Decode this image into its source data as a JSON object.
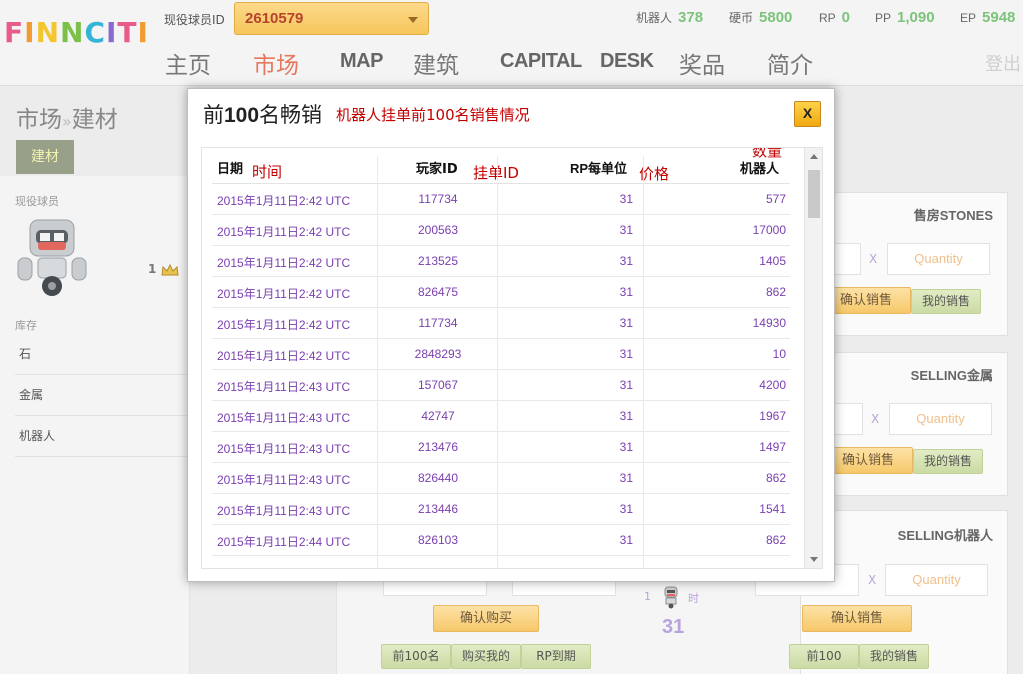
{
  "header": {
    "logo": "FINNCITI",
    "player_id_label": "现役球员ID",
    "player_id_value": "2610579",
    "stats": [
      {
        "label": "机器人",
        "value": "378"
      },
      {
        "label": "硬币",
        "value": "5800"
      },
      {
        "label": "RP",
        "value": "0"
      },
      {
        "label": "PP",
        "value": "1,090"
      },
      {
        "label": "EP",
        "value": "5948"
      }
    ],
    "nav": [
      "主页",
      "市场",
      "MAP",
      "建筑",
      "CAPITAL",
      "DESK",
      "奖品",
      "简介"
    ],
    "active_nav": "市场",
    "logout": "登出"
  },
  "left": {
    "breadcrumb_a": "市场",
    "breadcrumb_sep": "»",
    "breadcrumb_b": "建材",
    "tab": "建材",
    "player_title": "现役球员",
    "crown_count": "1",
    "inventory_title": "库存",
    "inventory": [
      "石",
      "金属",
      "机器人"
    ]
  },
  "sell_panels": [
    {
      "title": "售房STONES",
      "qty_placeholder": "Quantity",
      "x": "X",
      "confirm": "确认销售",
      "mine": "我的销售"
    },
    {
      "title": "SELLING金属",
      "qty_placeholder": "Quantity",
      "x": "X",
      "confirm": "确认销售",
      "mine": "我的销售"
    },
    {
      "title": "SELLING机器人",
      "qty_placeholder": "Quantity",
      "x": "X",
      "confirm": "确认销售",
      "mine": "我的销售"
    }
  ],
  "bottom": {
    "buy_confirm": "确认购买",
    "top100": "前100名",
    "buy_mine": "购买我的",
    "rp_expire": "RP到期",
    "small_1": "1",
    "shi": "时",
    "big_31": "31",
    "top100_right": "前100",
    "mine_right": "我的销售"
  },
  "modal": {
    "title_a": "前",
    "title_b": "100",
    "title_c": "名畅销",
    "annotation_title": "机器人挂单前100名销售情况",
    "close": "X",
    "columns": [
      "日期",
      "玩家ID",
      "RP每单位",
      "机器人"
    ],
    "annotations": {
      "date": "时间",
      "id": "挂单ID",
      "price": "价格",
      "qty": "数量"
    },
    "rows": [
      {
        "date": "2015年1月11日2:42 UTC",
        "id": "117734",
        "rp": "31",
        "robots": "577"
      },
      {
        "date": "2015年1月11日2:42 UTC",
        "id": "200563",
        "rp": "31",
        "robots": "17000"
      },
      {
        "date": "2015年1月11日2:42 UTC",
        "id": "213525",
        "rp": "31",
        "robots": "1405"
      },
      {
        "date": "2015年1月11日2:42 UTC",
        "id": "826475",
        "rp": "31",
        "robots": "862"
      },
      {
        "date": "2015年1月11日2:42 UTC",
        "id": "117734",
        "rp": "31",
        "robots": "14930"
      },
      {
        "date": "2015年1月11日2:42 UTC",
        "id": "2848293",
        "rp": "31",
        "robots": "10"
      },
      {
        "date": "2015年1月11日2:43 UTC",
        "id": "157067",
        "rp": "31",
        "robots": "4200"
      },
      {
        "date": "2015年1月11日2:43 UTC",
        "id": "42747",
        "rp": "31",
        "robots": "1967"
      },
      {
        "date": "2015年1月11日2:43 UTC",
        "id": "213476",
        "rp": "31",
        "robots": "1497"
      },
      {
        "date": "2015年1月11日2:43 UTC",
        "id": "826440",
        "rp": "31",
        "robots": "862"
      },
      {
        "date": "2015年1月11日2:43 UTC",
        "id": "213446",
        "rp": "31",
        "robots": "1541"
      },
      {
        "date": "2015年1月11日2:44 UTC",
        "id": "826103",
        "rp": "31",
        "robots": "862"
      }
    ]
  }
}
